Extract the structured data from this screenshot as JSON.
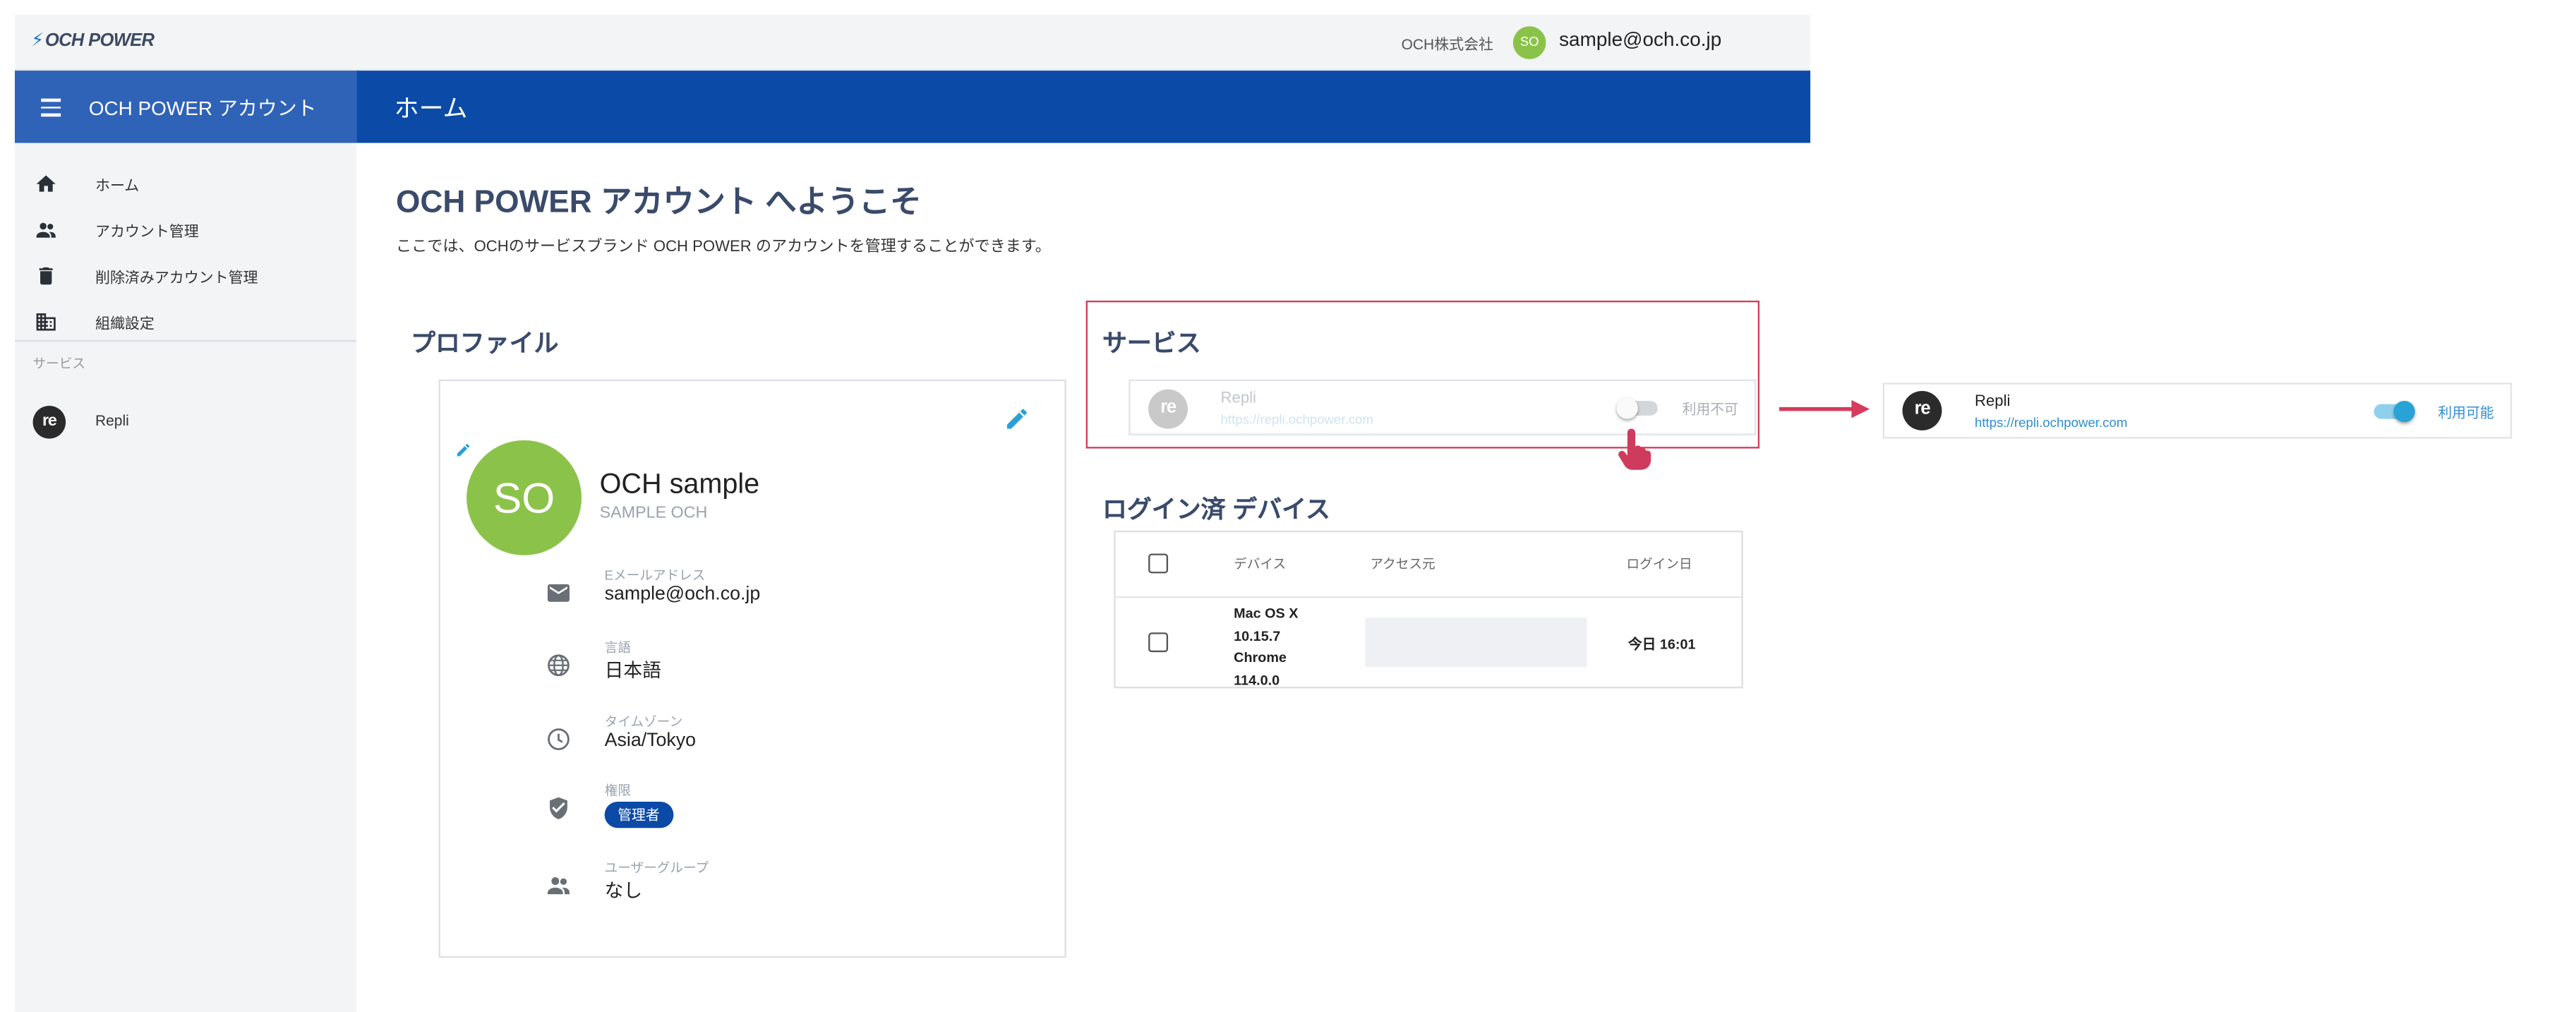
{
  "topbar": {
    "logo": "OCH POWER",
    "company": "OCH株式会社",
    "avatar_initials": "SO",
    "email": "sample@och.co.jp"
  },
  "sidebar": {
    "title": "OCH POWER アカウント",
    "items": [
      {
        "label": "ホーム",
        "icon": "home-icon"
      },
      {
        "label": "アカウント管理",
        "icon": "people-icon"
      },
      {
        "label": "削除済みアカウント管理",
        "icon": "trash-icon"
      },
      {
        "label": "組織設定",
        "icon": "building-icon"
      }
    ],
    "section_label": "サービス",
    "services": [
      {
        "label": "Repli",
        "logo": "re"
      }
    ]
  },
  "header": {
    "title": "ホーム"
  },
  "welcome": {
    "title": "OCH POWER アカウント へようこそ",
    "subtitle": "ここでは、OCHのサービスブランド OCH POWER のアカウントを管理することができます。"
  },
  "profile": {
    "heading": "プロファイル",
    "avatar_initials": "SO",
    "name": "OCH sample",
    "name_kana": "SAMPLE OCH",
    "fields": [
      {
        "label": "Eメールアドレス",
        "value": "sample@och.co.jp",
        "icon": "mail-icon"
      },
      {
        "label": "言語",
        "value": "日本語",
        "icon": "globe-icon"
      },
      {
        "label": "タイムゾーン",
        "value": "Asia/Tokyo",
        "icon": "clock-icon"
      },
      {
        "label": "権限",
        "value": "管理者",
        "icon": "shield-icon"
      },
      {
        "label": "ユーザーグループ",
        "value": "なし",
        "icon": "group-icon"
      }
    ]
  },
  "services": {
    "heading": "サービス",
    "before": {
      "logo": "re",
      "name": "Repli",
      "url": "https://repli.ochpower.com",
      "status": "利用不可",
      "enabled": false
    },
    "after": {
      "logo": "re",
      "name": "Repli",
      "url": "https://repli.ochpower.com",
      "status": "利用可能",
      "enabled": true
    }
  },
  "devices": {
    "heading": "ログイン済 デバイス",
    "columns": [
      "デバイス",
      "アクセス元",
      "ログイン日"
    ],
    "rows": [
      {
        "device_lines": [
          "Mac OS X",
          "10.15.7",
          "Chrome",
          "114.0.0"
        ],
        "access": "",
        "login": "今日 16:01"
      }
    ]
  },
  "colors": {
    "brand_blue": "#0b4aa7",
    "sidebar_head": "#2f63b8",
    "avatar_green": "#8bc34a",
    "highlight_red": "#d63b5b",
    "toggle_on": "#29a3d6"
  }
}
